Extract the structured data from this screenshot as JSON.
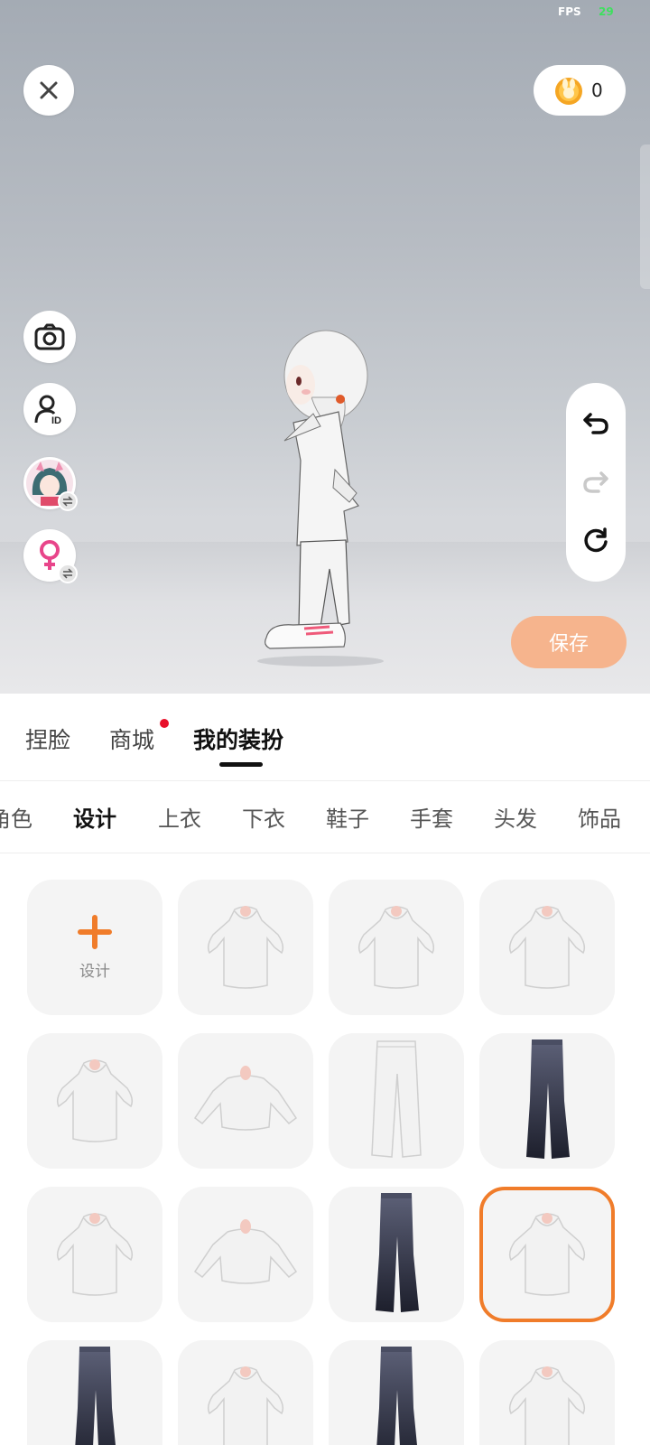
{
  "hud": {
    "fps_label": "FPS",
    "fps_value": "29"
  },
  "coins": {
    "icon": "bunny-coin-icon",
    "count": "0"
  },
  "left_tools": [
    "close-icon",
    "camera-icon",
    "person-id-icon",
    "avatar-switch-icon",
    "female-gender-icon"
  ],
  "history": [
    "undo-icon",
    "redo-icon",
    "reset-icon"
  ],
  "save_label": "保存",
  "main_tabs": [
    {
      "label": "捏脸",
      "active": false
    },
    {
      "label": "商城",
      "active": false,
      "notification": true
    },
    {
      "label": "我的装扮",
      "active": true
    }
  ],
  "sub_tabs": [
    {
      "label": "角色"
    },
    {
      "label": "设计",
      "active": true
    },
    {
      "label": "上衣"
    },
    {
      "label": "下衣"
    },
    {
      "label": "鞋子"
    },
    {
      "label": "手套"
    },
    {
      "label": "头发"
    },
    {
      "label": "饰品"
    }
  ],
  "grid": {
    "design_label": "设计",
    "items": [
      "add",
      "hoodie-dress",
      "hoodie-dress",
      "hoodie-dress",
      "hoodie-dress",
      "sweatshirt",
      "white-pants",
      "flare-jeans",
      "hoodie-dress",
      "sweatshirt",
      "flare-jeans",
      "hoodie-dress",
      "flare-jeans",
      "hoodie-dress",
      "flare-jeans",
      "hoodie-dress"
    ],
    "selected_index": 11
  },
  "colors": {
    "accent": "#f07c2a",
    "save_button": "#f6b48d",
    "notification": "#e8102a"
  }
}
